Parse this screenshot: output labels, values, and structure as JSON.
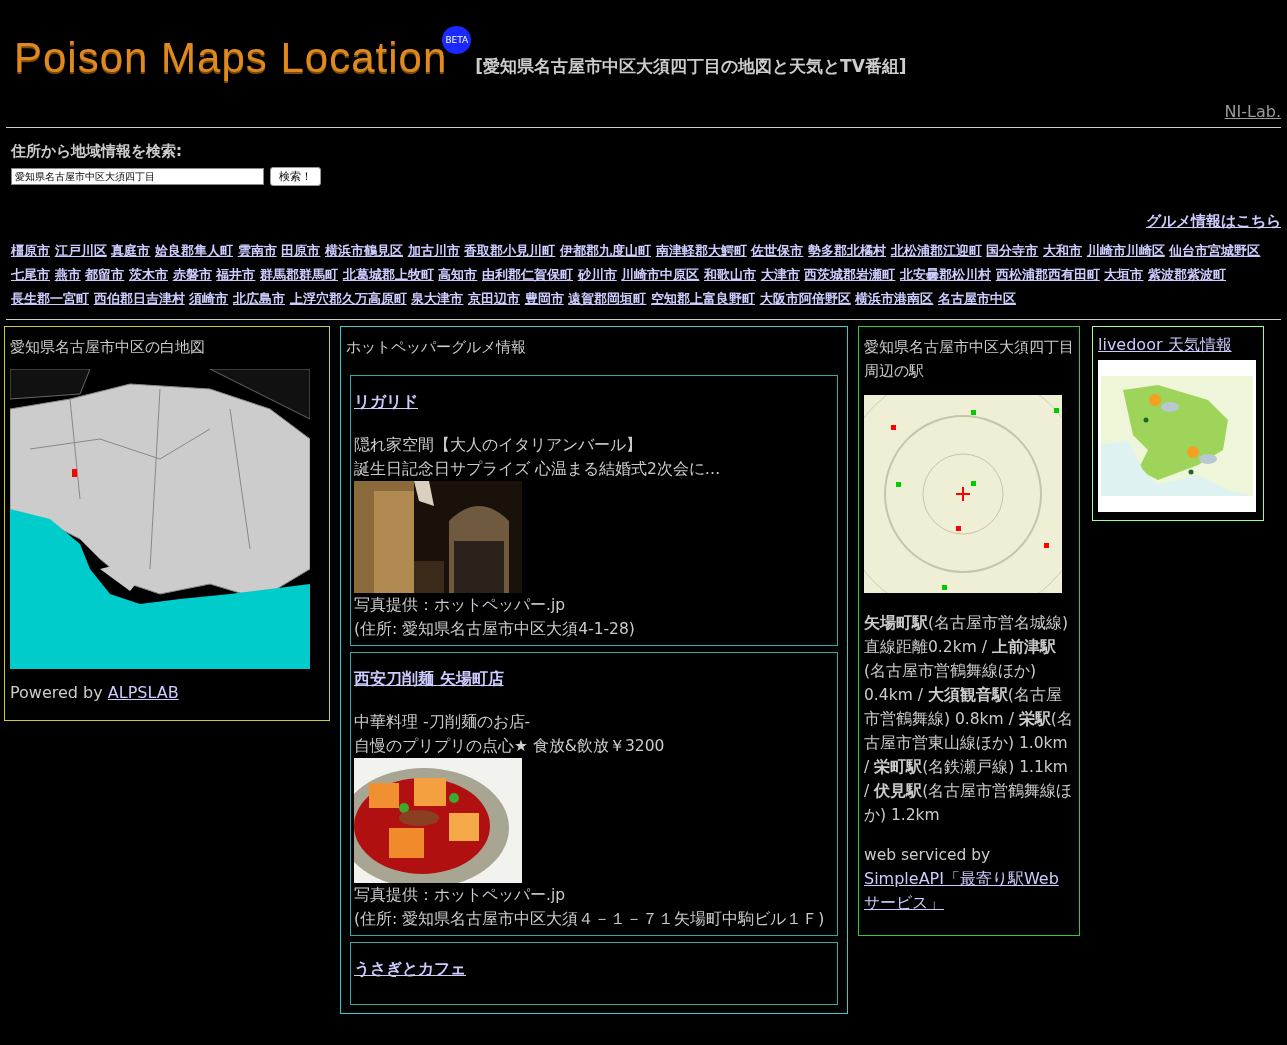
{
  "header": {
    "logo": "Poison Maps Location",
    "badge": "BETA",
    "title": "[愛知県名古屋市中区大須四丁目の地図と天気とTV番組]",
    "lab_link": "NI-Lab."
  },
  "search": {
    "label": "住所から地域情報を検索:",
    "value": "愛知県名古屋市中区大須四丁目",
    "button": "検索！"
  },
  "gourmet_link": "グルメ情報はこちら",
  "area_links": [
    "橿原市",
    "江戸川区",
    "真庭市",
    "姶良郡隼人町",
    "雲南市",
    "田原市",
    "横浜市鶴見区",
    "加古川市",
    "香取郡小見川町",
    "伊都郡九度山町",
    "南津軽郡大鰐町",
    "佐世保市",
    "勢多郡北橘村",
    "北松浦郡江迎町",
    "国分寺市",
    "大和市",
    "川崎市川崎区",
    "仙台市宮城野区",
    "七尾市",
    "燕市",
    "都留市",
    "茨木市",
    "赤磐市",
    "福井市",
    "群馬郡群馬町",
    "北葛城郡上牧町",
    "高知市",
    "由利郡仁賀保町",
    "砂川市",
    "川崎市中原区",
    "和歌山市",
    "大津市",
    "西茨城郡岩瀬町",
    "北安曇郡松川村",
    "西松浦郡西有田町",
    "大垣市",
    "紫波郡紫波町",
    "長生郡一宮町",
    "西伯郡日吉津村",
    "須崎市",
    "北広島市",
    "上浮穴郡久万高原町",
    "泉大津市",
    "京田辺市",
    "豊岡市",
    "遠賀郡岡垣町",
    "空知郡上富良野町",
    "大阪市阿倍野区",
    "横浜市港南区",
    "名古屋市中区"
  ],
  "map_panel": {
    "title": "愛知県名古屋市中区の白地図",
    "powered_by": "Powered by",
    "powered_link": "ALPSLAB"
  },
  "gourmet_panel": {
    "title": "ホットペッパーグルメ情報",
    "shops": [
      {
        "name": "リガリド",
        "lines": [
          "隠れ家空間【大人のイタリアンバール】",
          "誕生日記念日サプライズ 心温まる結婚式2次会に…"
        ],
        "photo": {
          "kind": "picture"
        },
        "credit": "写真提供：ホットペッパー.jp",
        "address": "(住所: 愛知県名古屋市中区大須4-1-28)"
      },
      {
        "name": "西安刀削麺 矢場町店",
        "lines": [
          "中華料理 -刀削麺のお店-",
          "自慢のプリプリの点心★ 食放&飲放￥3200"
        ],
        "photo": {
          "kind": "picture"
        },
        "credit": "写真提供：ホットペッパー.jp",
        "address": "(住所: 愛知県名古屋市中区大須４－１－７１矢場町中駒ビル１Ｆ)"
      },
      {
        "name": "うさぎとカフェ"
      }
    ]
  },
  "station_panel": {
    "title": "愛知県名古屋市中区大須四丁目周辺の駅",
    "description": "**矢場町駅**(名古屋市営名城線) 直線距離0.2km / **上前津駅**(名古屋市営鶴舞線ほか) 0.4km / **大須観音駅**(名古屋市営鶴舞線) 0.8km / **栄駅**(名古屋市営東山線ほか) 1.0km / **栄町駅**(名鉄瀬戸線) 1.1km / **伏見駅**(名古屋市営鶴舞線ほか) 1.2km",
    "serviced_by": "web serviced by",
    "service_link": "SimpleAPI「最寄り駅Webサービス」"
  },
  "weather_panel": {
    "title_link": "livedoor 天気情報"
  }
}
